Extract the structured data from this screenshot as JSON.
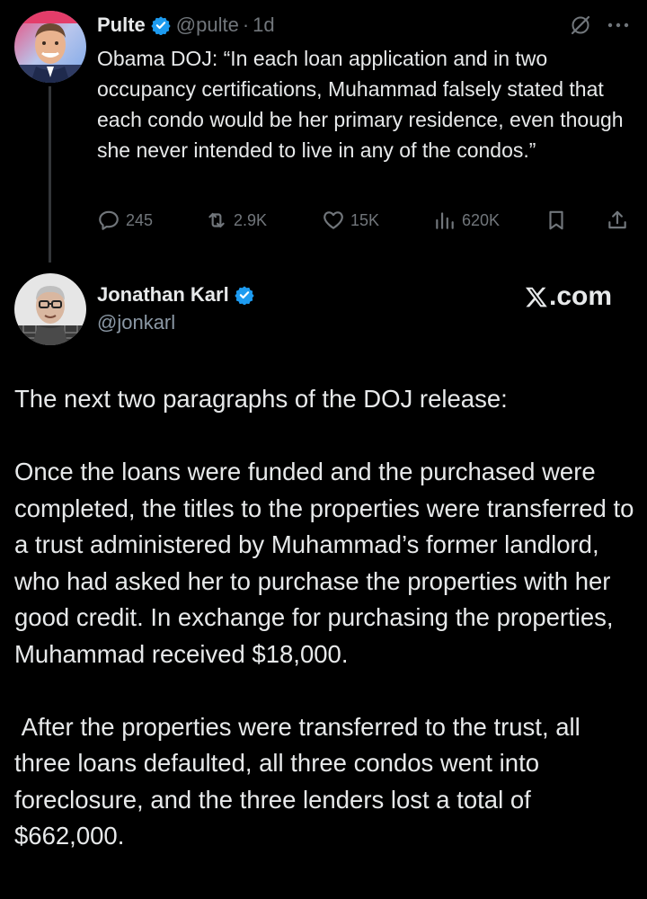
{
  "tweet": {
    "author_name": "Pulte",
    "handle": "@pulte",
    "separator": "·",
    "time": "1d",
    "text": "Obama DOJ: “In each loan application and in two occupancy certifications, Muhammad falsely stated that each condo would be her primary residence, even though she never intended to live in any of the condos.”",
    "actions": {
      "replies": "245",
      "reposts": "2.9K",
      "likes": "15K",
      "views": "620K"
    },
    "icons": {
      "verified": "verified-badge-icon",
      "grok": "grok-slash-icon",
      "more": "more-dots-icon",
      "reply": "reply-icon",
      "repost": "repost-icon",
      "like": "heart-icon",
      "views": "views-bar-chart-icon",
      "bookmark": "bookmark-icon",
      "share": "share-upload-icon"
    }
  },
  "embedded_post": {
    "author_name": "Jonathan Karl",
    "handle": "@jonkarl",
    "site_label": ".com",
    "paragraphs": [
      "The next two paragraphs of the DOJ release:",
      "Once the loans were funded and the purchased were completed, the titles to the properties were transferred to a trust administered by Muhammad’s former landlord, who had asked her to purchase the properties with her good credit. In exchange for purchasing the properties, Muhammad received $18,000.",
      " After the properties were transferred to the trust, all three loans defaulted, all three condos went into foreclosure, and the three lenders lost a total of $662,000."
    ]
  },
  "colors": {
    "background": "#000000",
    "text_primary": "#e7e9ea",
    "text_secondary": "#71767b",
    "verified_blue": "#1d9bf0"
  }
}
